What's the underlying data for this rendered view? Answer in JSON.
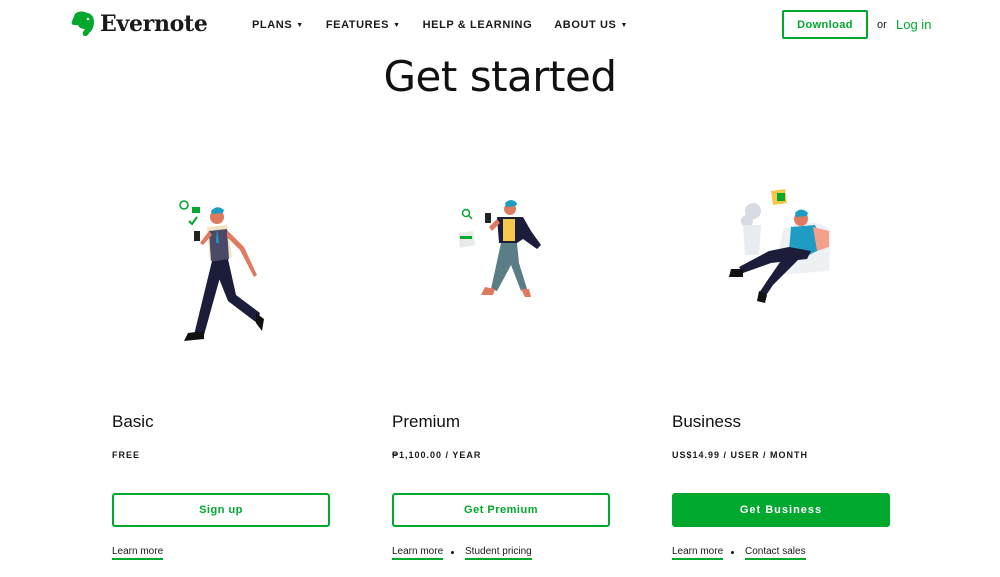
{
  "brand": {
    "name": "Evernote",
    "accent": "#00a82d"
  },
  "nav": {
    "items": [
      {
        "label": "PLANS",
        "has_menu": true
      },
      {
        "label": "FEATURES",
        "has_menu": true
      },
      {
        "label": "HELP & LEARNING",
        "has_menu": false
      },
      {
        "label": "ABOUT US",
        "has_menu": true
      }
    ],
    "download_label": "Download",
    "or_label": "or",
    "login_label": "Log in"
  },
  "page_title": "Get started",
  "plans": [
    {
      "name": "Basic",
      "price": "FREE",
      "cta": "Sign up",
      "cta_style": "outline",
      "links": [
        "Learn more"
      ],
      "illustration": "walking-man-illustration"
    },
    {
      "name": "Premium",
      "price": "₱1,100.00 / YEAR",
      "cta": "Get Premium",
      "cta_style": "outline",
      "links": [
        "Learn more",
        "Student pricing"
      ],
      "illustration": "walking-woman-illustration"
    },
    {
      "name": "Business",
      "price": "US$14.99 / USER / MONTH",
      "cta": "Get Business",
      "cta_style": "solid",
      "links": [
        "Learn more",
        "Contact sales"
      ],
      "illustration": "sitting-man-illustration"
    }
  ]
}
